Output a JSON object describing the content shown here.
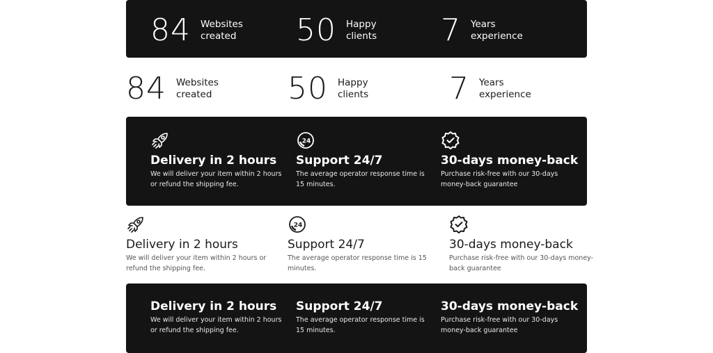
{
  "stats": [
    {
      "number": "84",
      "label_line1": "Websites",
      "label_line2": "created"
    },
    {
      "number": "50",
      "label_line1": "Happy",
      "label_line2": "clients"
    },
    {
      "number": "7",
      "label_line1": "Years",
      "label_line2": "experience"
    }
  ],
  "features": [
    {
      "icon": "rocket-icon",
      "title": "Delivery in 2 hours",
      "desc_dark_1": "We will deliver your item within 2 hours",
      "desc_dark_2": "or refund the shipping fee.",
      "desc_light_1": "We will deliver your item within 2 hours or",
      "desc_light_2": "refund the shipping fee."
    },
    {
      "icon": "support-24-icon",
      "title": "Support 24/7",
      "desc_dark_1": "The average operator response time is",
      "desc_dark_2": "15 minutes.",
      "desc_light_1": "The average operator response time is 15",
      "desc_light_2": "minutes."
    },
    {
      "icon": "badge-check-icon",
      "title": "30-days money-back",
      "desc_dark_1": "Purchase risk-free with our 30-days",
      "desc_dark_2": "money-back guarantee",
      "desc_light_1": "Purchase risk-free with our 30-days money-",
      "desc_light_2": "back guarantee"
    }
  ],
  "colors": {
    "dark_bg": "#141414",
    "light_bg": "#ffffff",
    "text_dark": "#1a1a1a"
  }
}
